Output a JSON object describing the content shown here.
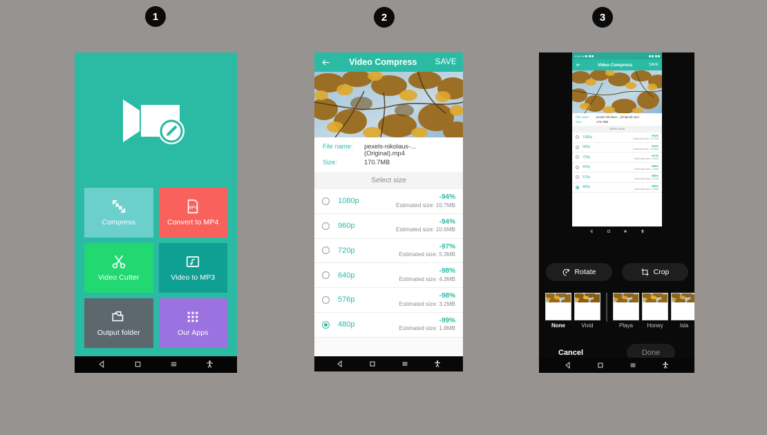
{
  "page": {
    "background_color": "#979391",
    "accent_teal": "#2bbba4"
  },
  "steps": [
    {
      "number": "1"
    },
    {
      "number": "2"
    },
    {
      "number": "3"
    }
  ],
  "phone1": {
    "logo_icon": "video-camera-edit-icon",
    "background_color": "#2bbba4",
    "tiles": [
      {
        "label": "Compress",
        "icon": "compress-arrows-icon",
        "color": "#6bcfcc"
      },
      {
        "label": "Convert to MP4",
        "icon": "mp4-file-icon",
        "color": "#f9625c"
      },
      {
        "label": "Video Cutter",
        "icon": "scissors-icon",
        "color": "#21d871"
      },
      {
        "label": "Video to MP3",
        "icon": "music-note-icon",
        "color": "#10a093"
      },
      {
        "label": "Output folder",
        "icon": "folder-icon",
        "color": "#5c686e"
      },
      {
        "label": "Our Apps",
        "icon": "apps-grid-icon",
        "color": "#9b72e0"
      }
    ],
    "navbar": {
      "back_icon": "nav-back-triangle-icon",
      "home_icon": "nav-home-square-icon",
      "recents_icon": "nav-menu-lines-icon",
      "accessibility_icon": "nav-accessibility-person-icon"
    }
  },
  "phone2": {
    "appbar": {
      "back_icon": "arrow-left-icon",
      "title": "Video Compress",
      "save_label": "SAVE"
    },
    "video_preview": "autumn-leaves-video-thumbnail",
    "meta": {
      "file_name_key": "File name:",
      "file_name_value": "pexels-nikolaus-...(Original).mp4",
      "size_key": "Size:",
      "size_value": "170.7MB"
    },
    "select_size_header": "Select size",
    "estimated_prefix": "Estimated size:",
    "options": [
      {
        "resolution": "1080p",
        "percent": "-94%",
        "estimated": "Estimated size: 10.7MB",
        "selected": false
      },
      {
        "resolution": "960p",
        "percent": "-94%",
        "estimated": "Estimated size: 10.6MB",
        "selected": false
      },
      {
        "resolution": "720p",
        "percent": "-97%",
        "estimated": "Estimated size: 5.3MB",
        "selected": false
      },
      {
        "resolution": "640p",
        "percent": "-98%",
        "estimated": "Estimated size: 4.3MB",
        "selected": false
      },
      {
        "resolution": "576p",
        "percent": "-98%",
        "estimated": "Estimated size: 3.2MB",
        "selected": false
      },
      {
        "resolution": "480p",
        "percent": "-99%",
        "estimated": "Estimated size: 1.8MB",
        "selected": true
      }
    ],
    "navbar": {
      "back_icon": "nav-back-triangle-icon",
      "home_icon": "nav-home-square-icon",
      "recents_icon": "nav-menu-lines-icon",
      "accessibility_icon": "nav-accessibility-person-icon"
    }
  },
  "phone3": {
    "statusbar": {
      "clock": "9:48 PM"
    },
    "appbar": {
      "back_icon": "arrow-left-icon",
      "title": "Video Compress",
      "save_label": "SAVE"
    },
    "meta": {
      "file_name_key": "File name:",
      "file_name_value": "pexels-nikolaus-...(Original).mp4",
      "size_key": "Size:",
      "size_value": "170.7MB"
    },
    "select_size_header": "Select size",
    "options": [
      {
        "resolution": "1080p",
        "percent": "-94%",
        "estimated": "Estimated size: 10.7MB",
        "selected": false
      },
      {
        "resolution": "960p",
        "percent": "-94%",
        "estimated": "Estimated size: 10.6MB",
        "selected": false
      },
      {
        "resolution": "720p",
        "percent": "-97%",
        "estimated": "Estimated size: 5.3MB",
        "selected": false
      },
      {
        "resolution": "640p",
        "percent": "-98%",
        "estimated": "Estimated size: 4.3MB",
        "selected": false
      },
      {
        "resolution": "576p",
        "percent": "-98%",
        "estimated": "Estimated size: 3.2MB",
        "selected": false
      },
      {
        "resolution": "480p",
        "percent": "-99%",
        "estimated": "Estimated size: 1.8MB",
        "selected": true
      }
    ],
    "tools": [
      {
        "label": "Rotate",
        "icon": "rotate-icon"
      },
      {
        "label": "Crop",
        "icon": "crop-icon"
      }
    ],
    "filters": [
      {
        "name": "None",
        "selected": true
      },
      {
        "name": "Vivid",
        "selected": false
      },
      {
        "name": "Playa",
        "selected": false
      },
      {
        "name": "Honey",
        "selected": false
      },
      {
        "name": "Isla",
        "selected": false
      }
    ],
    "actions": {
      "cancel_label": "Cancel",
      "done_label": "Done"
    },
    "navbar": {
      "back_icon": "nav-back-triangle-icon",
      "home_icon": "nav-home-square-icon",
      "recents_icon": "nav-menu-lines-icon",
      "accessibility_icon": "nav-accessibility-person-icon"
    }
  }
}
